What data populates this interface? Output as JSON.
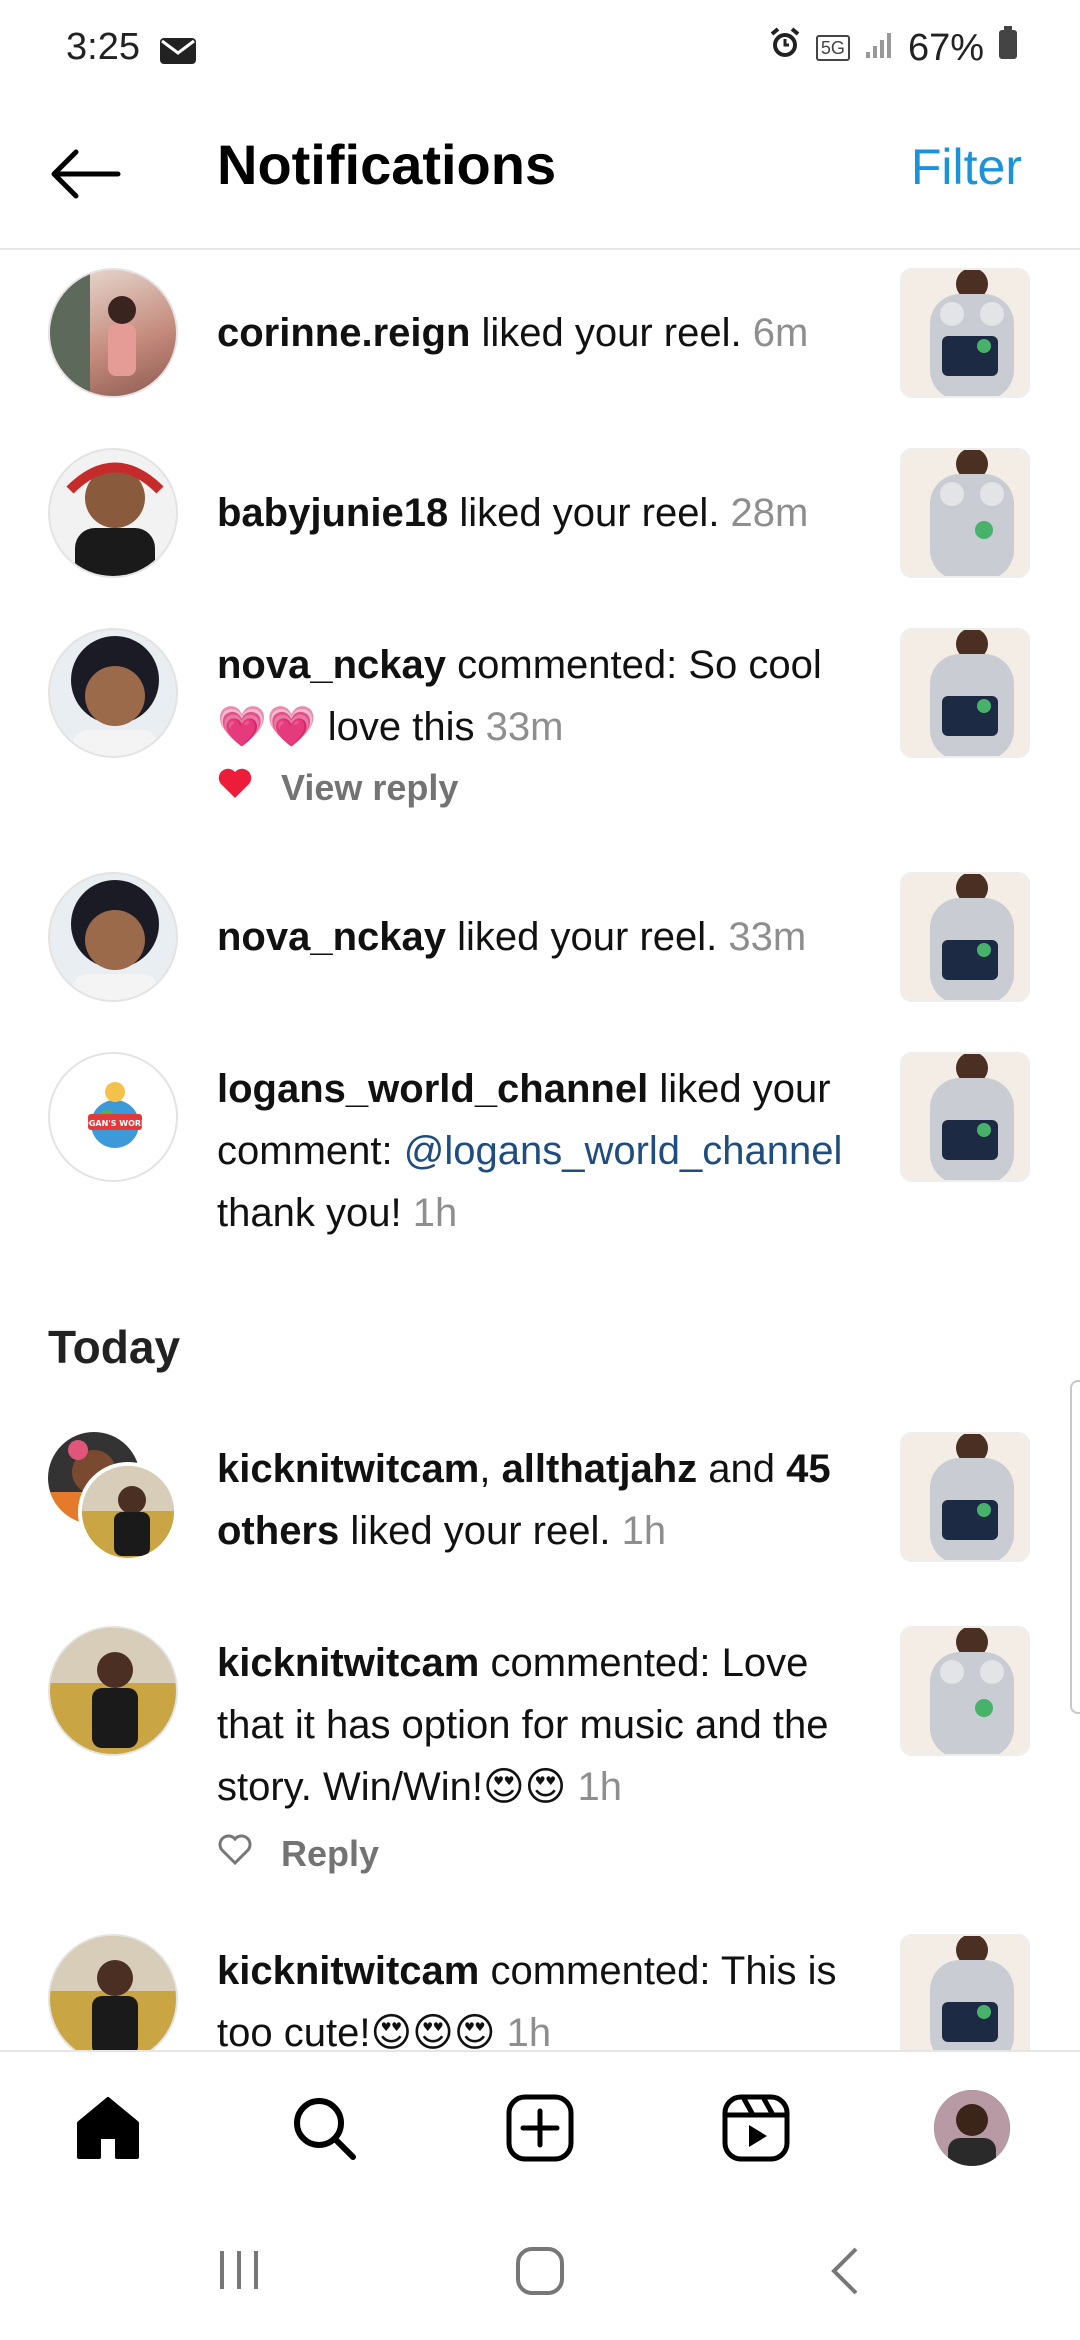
{
  "status_bar": {
    "time": "3:25",
    "network": "5G",
    "battery": "67%"
  },
  "header": {
    "title": "Notifications",
    "filter_label": "Filter"
  },
  "notifications": [
    {
      "user": "corinne.reign",
      "action": " liked your reel.",
      "time": " 6m"
    },
    {
      "user": "babyjunie18",
      "action": " liked your reel.",
      "time": " 28m"
    },
    {
      "user": "nova_nckay",
      "action": " commented: So cool ",
      "emoji": "💗💗",
      "action2": " love this",
      "time": " 33m",
      "sub_action": "View reply"
    },
    {
      "user": "nova_nckay",
      "action": " liked your reel.",
      "time": " 33m"
    },
    {
      "user": "logans_world_channel",
      "action": " liked your comment: ",
      "mention": "@logans_world_channel",
      "action2": " thank you!",
      "time": " 1h",
      "avatar_text": "LOGAN'S WORLD"
    }
  ],
  "today_section": {
    "title": "Today",
    "items": [
      {
        "user": "kicknitwitcam",
        "sep": ", ",
        "user2": "allthatjahz",
        "mid": " and ",
        "others": "45 others",
        "action": " liked your reel.",
        "time": " 1h"
      },
      {
        "user": "kicknitwitcam",
        "action": " commented: Love that it has option for music and the story. Win/Win!",
        "emoji": "😍😍",
        "time": " 1h",
        "sub_action": "Reply"
      },
      {
        "user": "kicknitwitcam",
        "action": " commented: This is too cute!",
        "emoji": "😍😍😍",
        "time": " 1h"
      }
    ]
  },
  "bottom_nav": [
    "home-icon",
    "search-icon",
    "create-icon",
    "reels-icon",
    "profile-avatar"
  ],
  "colors": {
    "accent": "#1a92dc",
    "mention": "#1f4d7f",
    "like_red": "#ed1c3a",
    "time_gray": "#8e8e8e"
  }
}
